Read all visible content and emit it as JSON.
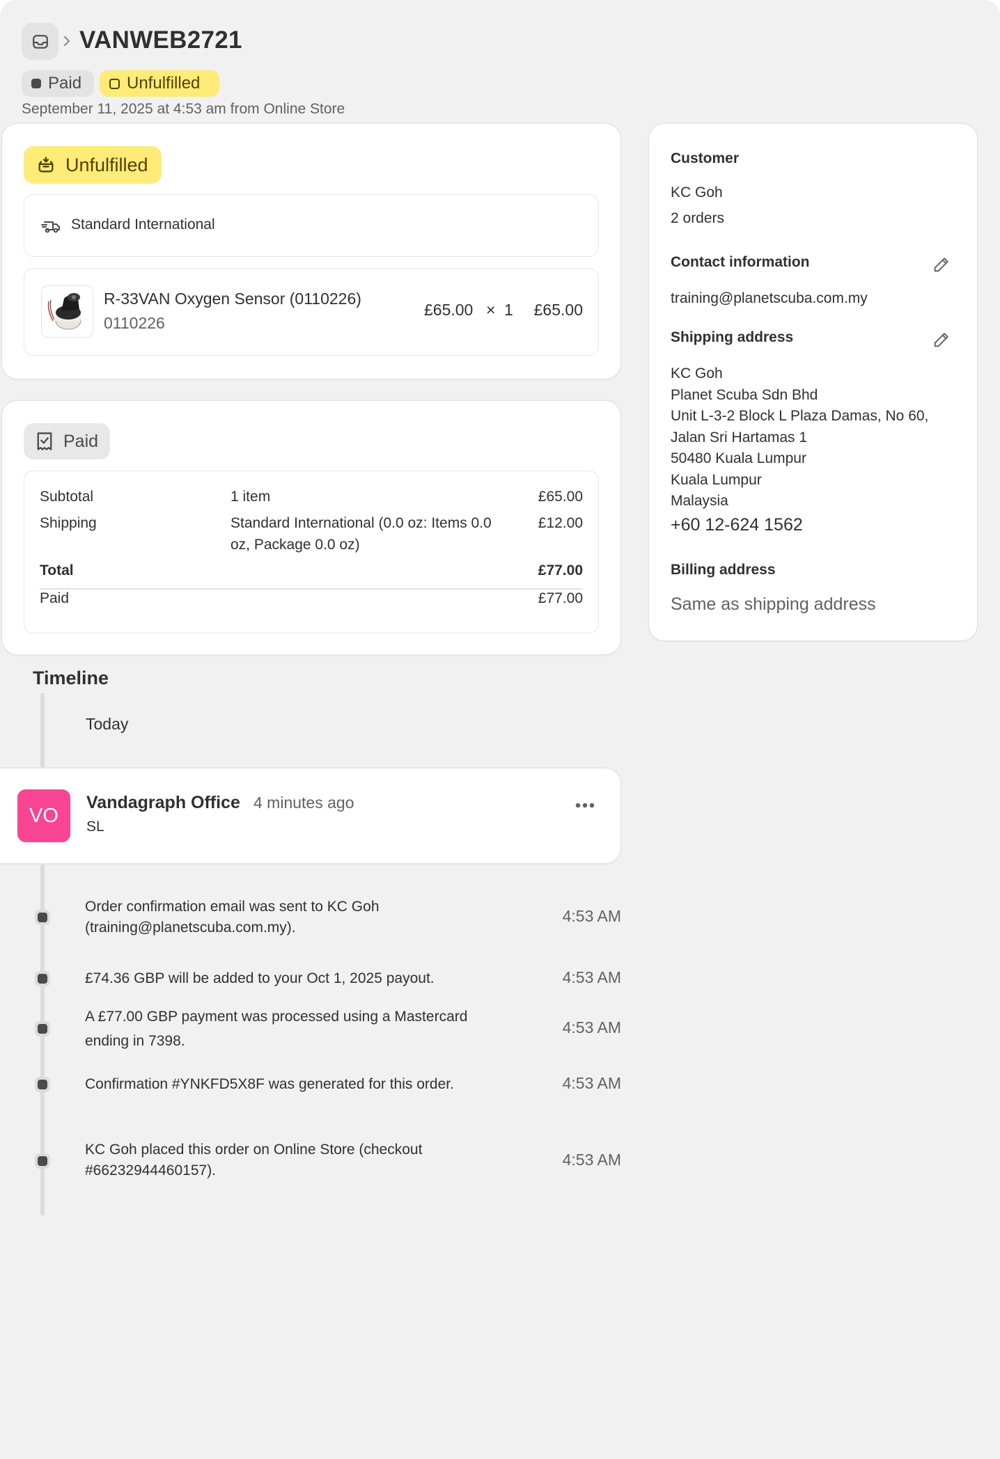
{
  "header": {
    "order_id": "VANWEB2721",
    "chevron": "›",
    "badge_paid": "Paid",
    "badge_unfulfilled": "Unfulfilled",
    "meta": "September 11, 2025 at 4:53 am from Online Store"
  },
  "fulfillment": {
    "status_label": "Unfulfilled",
    "shipping_method": "Standard International",
    "item": {
      "name": "R-33VAN Oxygen Sensor (0110226)",
      "sku": "0110226",
      "price": "£65.00",
      "times": "×",
      "quantity": "1",
      "total": "£65.00"
    }
  },
  "payment": {
    "status_label": "Paid",
    "rows": {
      "subtotal_label": "Subtotal",
      "subtotal_desc": "1 item",
      "subtotal_amount": "£65.00",
      "shipping_label": "Shipping",
      "shipping_desc_line1": "Standard International (0.0 oz: Items 0.0",
      "shipping_desc_line2": "oz, Package 0.0 oz)",
      "shipping_amount": "£12.00",
      "total_label": "Total",
      "total_amount": "£77.00",
      "paid_label": "Paid",
      "paid_amount": "£77.00"
    }
  },
  "customer": {
    "title": "Customer",
    "name": "KC Goh",
    "orders": "2 orders",
    "contact_title": "Contact information",
    "email": "training@planetscuba.com.my",
    "shipping_title": "Shipping address",
    "shipping_address": [
      "KC Goh",
      "Planet Scuba Sdn Bhd",
      "Unit L-3-2 Block L Plaza Damas, No 60,",
      "Jalan Sri Hartamas 1",
      "50480 Kuala Lumpur",
      "Kuala Lumpur",
      "Malaysia"
    ],
    "phone": "+60 12-624 1562",
    "billing_title": "Billing address",
    "billing_value": "Same as shipping address"
  },
  "timeline": {
    "title": "Timeline",
    "today": "Today",
    "comment": {
      "avatar_initials": "VO",
      "avatar_color": "#f74593",
      "author": "Vandagraph Office",
      "time": "4 minutes ago",
      "text": "SL"
    },
    "events": [
      {
        "line1": "Order confirmation email was sent to KC Goh",
        "line2": "(training@planetscuba.com.my).",
        "time": "4:53 AM"
      },
      {
        "line1": "£74.36 GBP will be added to your Oct 1, 2025 payout.",
        "line2": "",
        "time": "4:53 AM"
      },
      {
        "line1": "A £77.00 GBP payment was processed using a Mastercard",
        "line2": "ending in 7398.",
        "time": "4:53 AM"
      },
      {
        "line1": "Confirmation #YNKFD5X8F was generated for this order.",
        "line2": "",
        "time": "4:53 AM"
      },
      {
        "line1": "KC Goh placed this order on Online Store (checkout",
        "line2": "#66232944460157).",
        "time": "4:53 AM"
      }
    ]
  },
  "colors": {
    "unfulfilled_bg": "#ffeb78",
    "paid_bg": "#e3e3e3",
    "page_bg": "#f1f1f1"
  },
  "icons": [
    "inbox-icon",
    "truck-icon",
    "box-icon",
    "receipt-check-icon",
    "pencil-icon",
    "more-horizontal-icon"
  ]
}
